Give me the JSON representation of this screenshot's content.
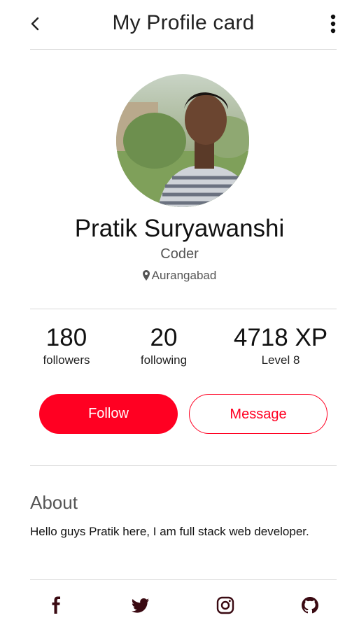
{
  "header": {
    "title": "My Profile card"
  },
  "profile": {
    "name": "Pratik Suryawanshi",
    "role": "Coder",
    "location": "Aurangabad"
  },
  "stats": [
    {
      "value": "180",
      "label": "followers"
    },
    {
      "value": "20",
      "label": "following"
    },
    {
      "value": "4718 XP",
      "label": "Level 8"
    }
  ],
  "actions": {
    "follow_label": "Follow",
    "message_label": "Message"
  },
  "about": {
    "title": "About",
    "text": "Hello guys Pratik here, I am full stack web developer."
  },
  "social_icons": [
    "facebook-icon",
    "twitter-icon",
    "instagram-icon",
    "github-icon"
  ],
  "colors": {
    "accent": "#ff0022",
    "divider": "#d9d9d9",
    "icon_dark": "#3a0a12"
  }
}
